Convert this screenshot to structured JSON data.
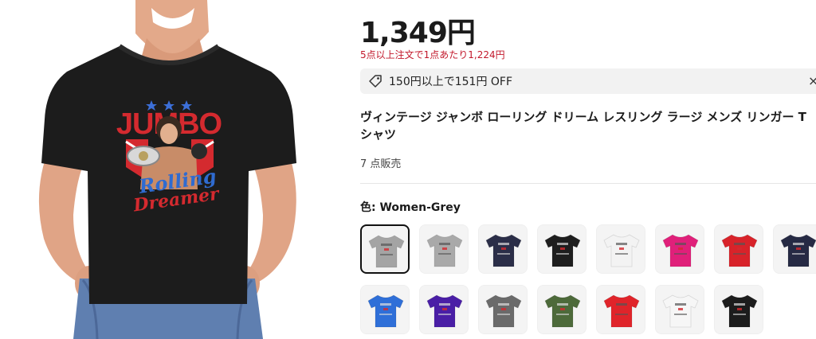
{
  "product": {
    "price": "1,349円",
    "bulk_offer": "5点以上注文で1点あたり1,224円",
    "coupon_text": "150円以上で151円 OFF",
    "coupon_close": "×",
    "title": "ヴィンテージ ジャンボ ローリング ドリーム レスリング ラージ メンズ リンガー T シャツ",
    "sold_count": "7 点販売",
    "color_prefix": "色: ",
    "selected_color": "Women-Grey",
    "shirt_print": {
      "top": "JUMBO",
      "script1": "Rolling",
      "script2": "Dreamer"
    }
  },
  "colors": [
    {
      "name": "Women-Grey",
      "hex": "#a4a4a4",
      "selected": true
    },
    {
      "name": "grey",
      "hex": "#a9a9a9",
      "selected": false
    },
    {
      "name": "navy",
      "hex": "#2b2e48",
      "selected": false
    },
    {
      "name": "black",
      "hex": "#1e1e1e",
      "selected": false
    },
    {
      "name": "white",
      "hex": "#f3f3f3",
      "selected": false
    },
    {
      "name": "pink",
      "hex": "#e0207a",
      "selected": false
    },
    {
      "name": "red",
      "hex": "#d8232a",
      "selected": false
    },
    {
      "name": "dark-navy",
      "hex": "#262a44",
      "selected": false
    },
    {
      "name": "blue",
      "hex": "#2f6fd8",
      "selected": false
    },
    {
      "name": "purple",
      "hex": "#4a1ea6",
      "selected": false
    },
    {
      "name": "charcoal",
      "hex": "#6a6a6a",
      "selected": false
    },
    {
      "name": "army-green",
      "hex": "#4d6a3a",
      "selected": false
    },
    {
      "name": "bright-red",
      "hex": "#e0242a",
      "selected": false
    },
    {
      "name": "white-2",
      "hex": "#f6f6f6",
      "selected": false
    },
    {
      "name": "black-2",
      "hex": "#1c1c1c",
      "selected": false
    }
  ],
  "theme": {
    "bulk_color": "#c2182b",
    "coupon_bg": "#f2f2f2"
  }
}
